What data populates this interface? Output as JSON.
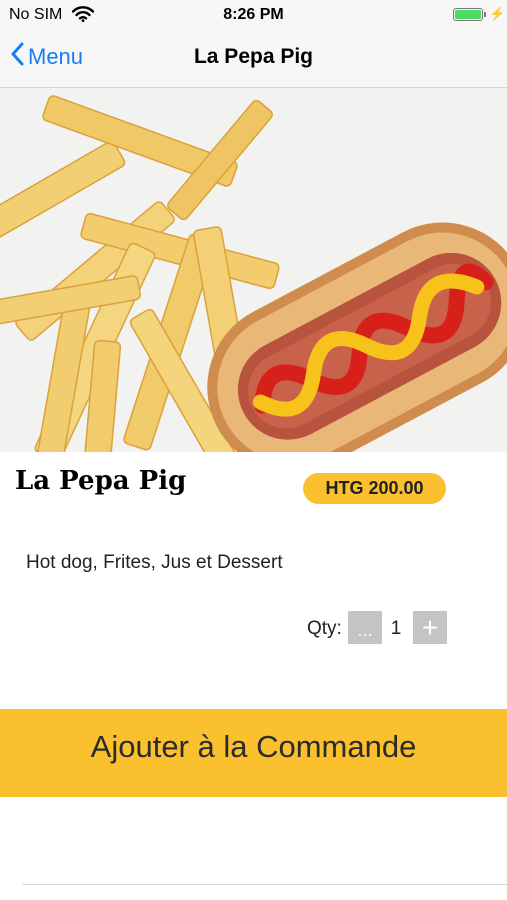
{
  "status_bar": {
    "carrier": "No SIM",
    "time": "8:26 PM",
    "battery_level": 1.0,
    "icons": [
      "wifi-icon",
      "battery-icon",
      "charging-bolt-icon"
    ]
  },
  "nav": {
    "back_label": "Menu",
    "title": "La Pepa Pig",
    "back_icon": "chevron-left-icon"
  },
  "product": {
    "image": "hotdog-and-fries-photo",
    "name": "La Pepa Pig",
    "price": "HTG 200.00",
    "description": "Hot dog, Frites, Jus et Dessert"
  },
  "quantity": {
    "label": "Qty:",
    "minus_label": "...",
    "value": "1",
    "plus_label": "+"
  },
  "actions": {
    "add_label": "Ajouter à la Commande"
  },
  "colors": {
    "accent": "#fbc02d",
    "nav_tint": "#1a7cf5",
    "stepper_gray": "#c4c4c4"
  }
}
